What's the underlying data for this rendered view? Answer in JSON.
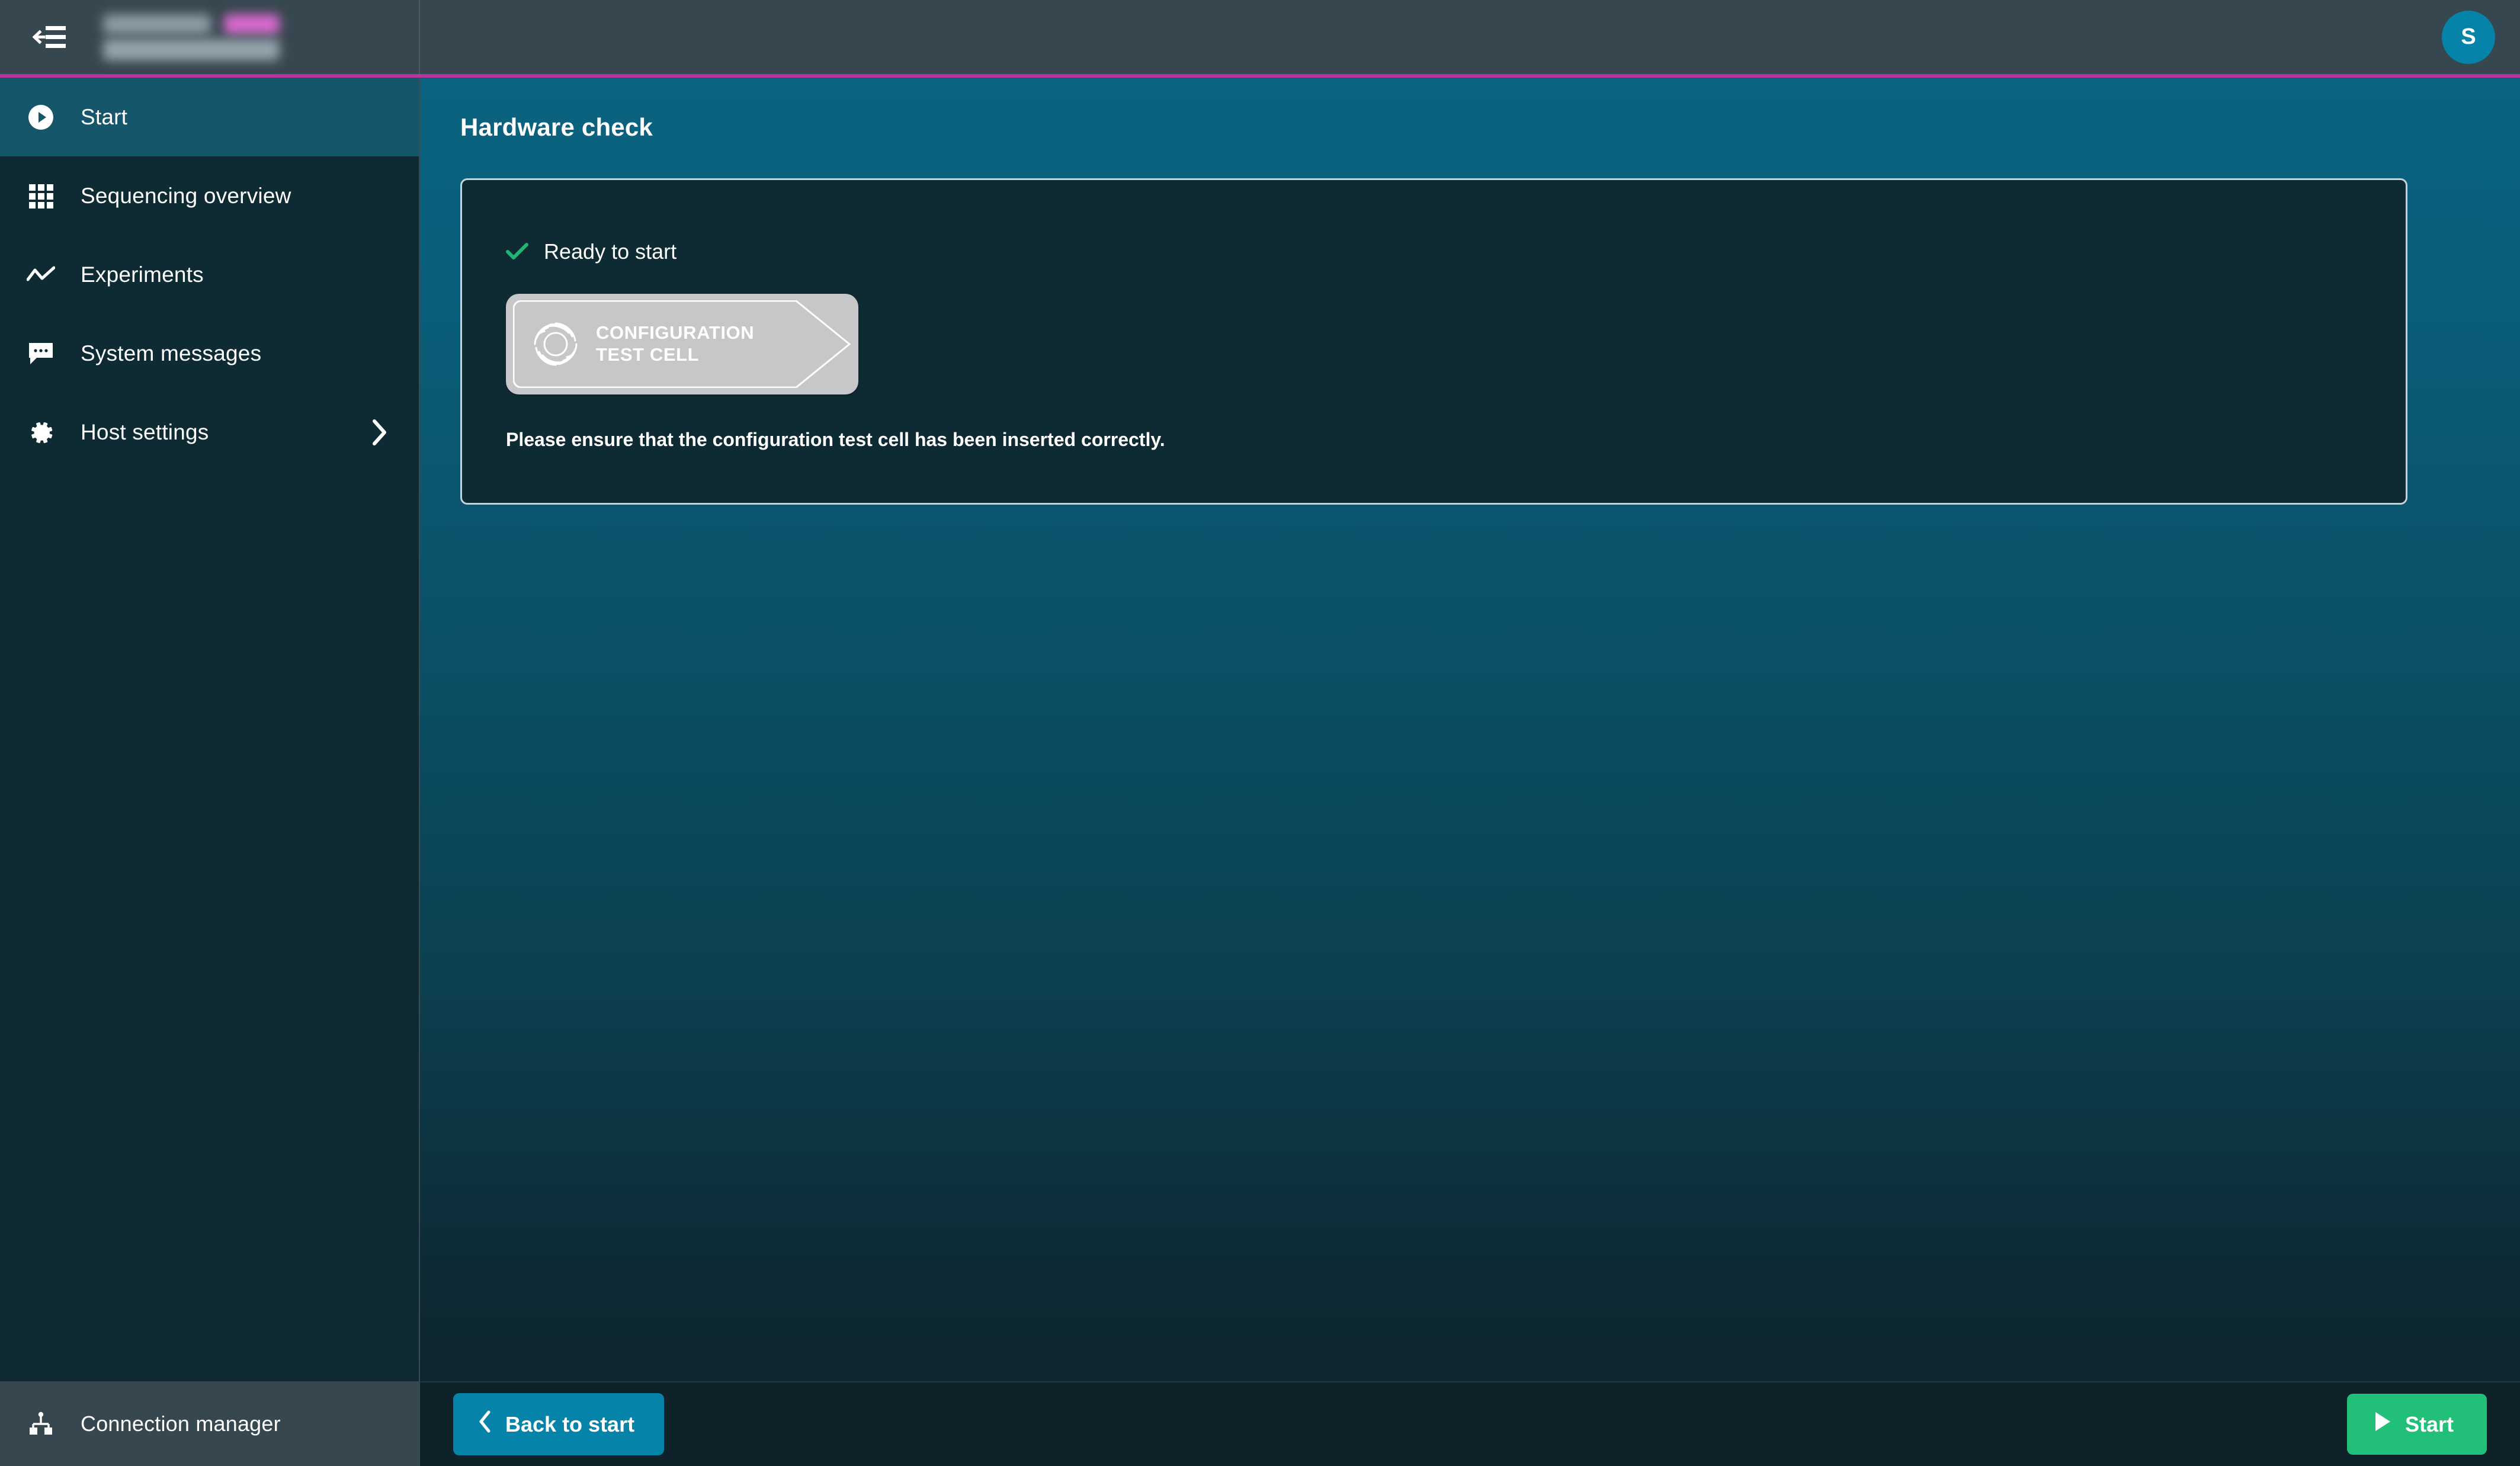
{
  "topbar": {
    "menu_toggle_name": "collapse-menu",
    "host_name_redacted": "███████",
    "host_badge_redacted": "████",
    "host_subtitle_redacted": "██████████",
    "avatar_initial": "S",
    "accent_color": "#b5369f",
    "avatar_color": "#0683a8"
  },
  "sidebar": {
    "items": [
      {
        "label": "Start",
        "icon": "play-circle-icon",
        "active": true,
        "has_chevron": false
      },
      {
        "label": "Sequencing overview",
        "icon": "grid-icon",
        "active": false,
        "has_chevron": false
      },
      {
        "label": "Experiments",
        "icon": "line-chart-icon",
        "active": false,
        "has_chevron": false
      },
      {
        "label": "System messages",
        "icon": "message-icon",
        "active": false,
        "has_chevron": false
      },
      {
        "label": "Host settings",
        "icon": "gear-icon",
        "active": false,
        "has_chevron": true
      }
    ],
    "footer": {
      "label": "Connection manager",
      "icon": "network-icon"
    }
  },
  "main": {
    "page_title": "Hardware check",
    "card": {
      "status_label": "Ready to start",
      "status_icon": "check-icon",
      "status_color": "#21b573",
      "flowcell": {
        "line1": "CONFIGURATION",
        "line2": "TEST CELL"
      },
      "hint": "Please ensure that the configuration test cell has been inserted correctly."
    }
  },
  "footer": {
    "back_label": "Back to start",
    "back_icon": "chevron-left-icon",
    "back_color": "#0683a8",
    "start_label": "Start",
    "start_icon": "play-triangle-icon",
    "start_color": "#21bf77"
  }
}
